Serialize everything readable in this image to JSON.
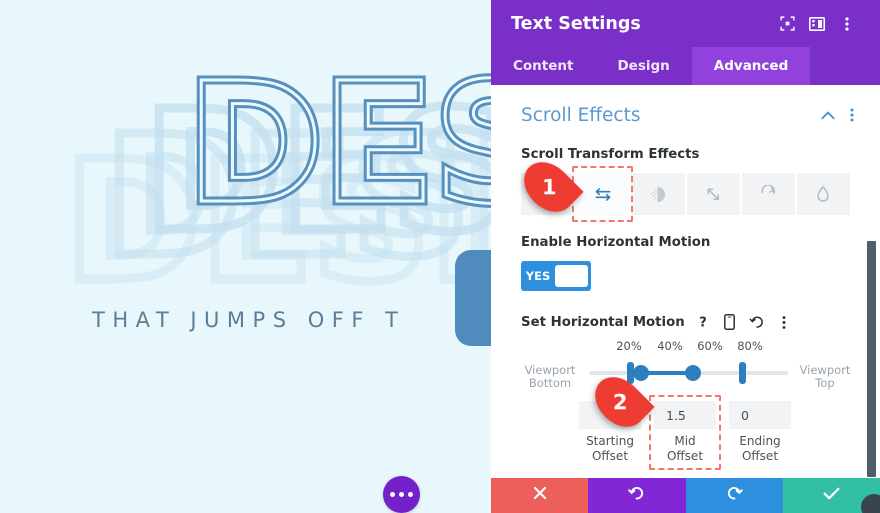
{
  "canvas": {
    "headline_word": "DESIGN",
    "subtitle": "THAT JUMPS OFF T",
    "more_options_icon": "ellipsis-icon"
  },
  "panel": {
    "title": "Text Settings",
    "header_icons": [
      {
        "name": "focus-frame-icon",
        "label": "focus-frame-icon"
      },
      {
        "name": "layout-panel-icon",
        "label": "layout-panel-icon"
      },
      {
        "name": "kebab-menu-icon",
        "label": "kebab-menu-icon"
      }
    ],
    "tabs": [
      {
        "label": "Content",
        "active": false
      },
      {
        "label": "Design",
        "active": false
      },
      {
        "label": "Advanced",
        "active": true
      }
    ],
    "section": {
      "title": "Scroll Effects",
      "collapse_icon": "chevron-up-icon",
      "menu_icon": "kebab-menu-icon"
    },
    "transform_effects": {
      "label": "Scroll Transform Effects",
      "options": [
        {
          "name": "vertical-motion-icon",
          "selected": false
        },
        {
          "name": "horizontal-motion-icon",
          "selected": true
        },
        {
          "name": "fade-icon",
          "selected": false
        },
        {
          "name": "scale-icon",
          "selected": false
        },
        {
          "name": "rotate-icon",
          "selected": false
        },
        {
          "name": "blur-icon",
          "selected": false
        }
      ]
    },
    "enable_horizontal_motion": {
      "label": "Enable Horizontal Motion",
      "value": "YES"
    },
    "set_horizontal_motion": {
      "label": "Set Horizontal Motion",
      "icons": [
        {
          "name": "help-icon"
        },
        {
          "name": "mobile-device-icon"
        },
        {
          "name": "reset-icon"
        },
        {
          "name": "kebab-menu-icon"
        }
      ],
      "ticks": [
        "20%",
        "40%",
        "60%",
        "80%"
      ],
      "viewport_bottom_line1": "Viewport",
      "viewport_bottom_line2": "Bottom",
      "viewport_top_line1": "Viewport",
      "viewport_top_line2": "Top",
      "offsets": [
        {
          "value": "",
          "caption_line1": "Starting",
          "caption_line2": "Offset",
          "highlight": false
        },
        {
          "value": "1.5",
          "caption_line1": "Mid",
          "caption_line2": "Offset",
          "highlight": true
        },
        {
          "value": "0",
          "caption_line1": "Ending",
          "caption_line2": "Offset",
          "highlight": false
        }
      ]
    },
    "actions": [
      {
        "name": "cancel-button",
        "icon": "close-icon"
      },
      {
        "name": "undo-button",
        "icon": "undo-icon"
      },
      {
        "name": "redo-button",
        "icon": "redo-icon"
      },
      {
        "name": "save-button",
        "icon": "check-icon"
      }
    ]
  },
  "markers": [
    {
      "number": "1"
    },
    {
      "number": "2"
    }
  ],
  "colors": {
    "panel_purple": "#7b2fc9",
    "tab_active": "#9241dd",
    "section_blue": "#5a9ad1",
    "accent_blue": "#2d8fdd",
    "marker_red": "#ef3c33",
    "canvas_bg": "#e8f7fb",
    "save_green": "#33bfa3"
  }
}
